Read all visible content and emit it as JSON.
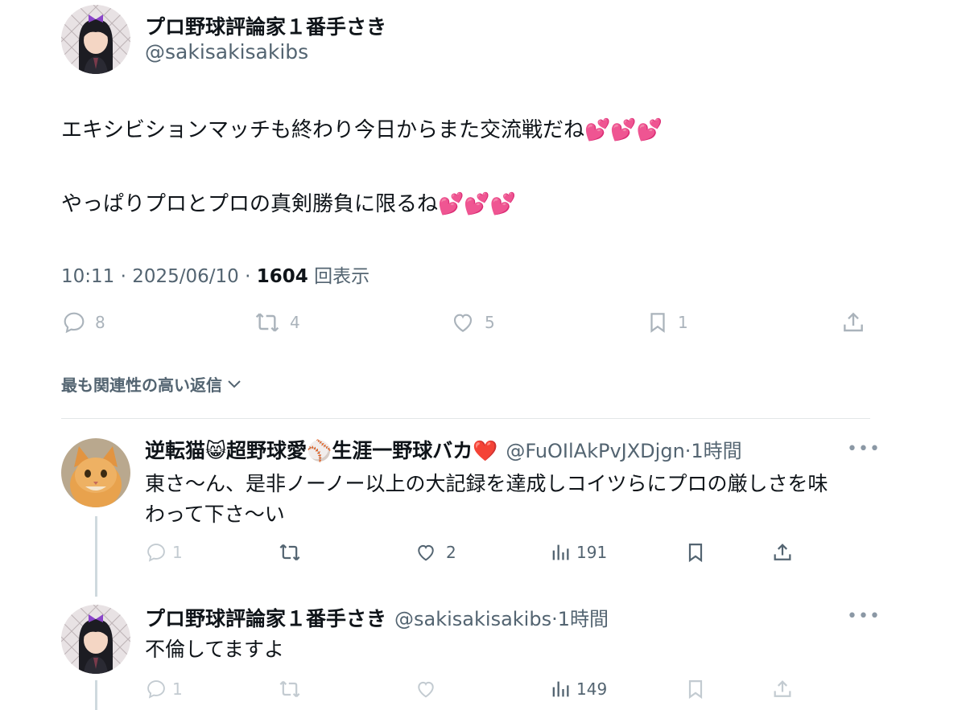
{
  "main_tweet": {
    "author_name": "プロ野球評論家１番手さき",
    "author_handle": "@sakisakisakibs",
    "line1": "エキシビションマッチも終わり今日からまた交流戦だね💕💕💕",
    "line2": "やっぱりプロとプロの真剣勝負に限るね💕💕💕",
    "time": "10:11",
    "date": "2025/06/10",
    "views_count": "1604",
    "views_label": "回表示",
    "actions": {
      "replies": "8",
      "retweets": "4",
      "likes": "5",
      "bookmarks": "1"
    }
  },
  "sort_label": "最も関連性の高い返信",
  "replies": [
    {
      "author_name": "逆転猫😸超野球愛⚾生涯一野球バカ❤️",
      "author_handle": "@FuOIlAkPvJXDjgn",
      "time": "·1時間",
      "text_line1": "東さ〜ん、是非ノーノー以上の大記録を達成しコイツらにプロの厳しさを味",
      "text_line2": "わって下さ〜い",
      "actions": {
        "replies": "1",
        "retweets": "",
        "likes": "2",
        "views": "191"
      }
    },
    {
      "author_name": "プロ野球評論家１番手さき",
      "author_handle": "@sakisakisakibs",
      "time": "·1時間",
      "text_line1": "不倫してますよ",
      "actions": {
        "replies": "1",
        "retweets": "",
        "likes": "",
        "views": "149"
      }
    }
  ],
  "more_icon": "•••",
  "colors": {
    "text": "#0f1419",
    "secondary": "#536471",
    "icon": "#8b98a5",
    "divider": "#e3e6e8"
  }
}
